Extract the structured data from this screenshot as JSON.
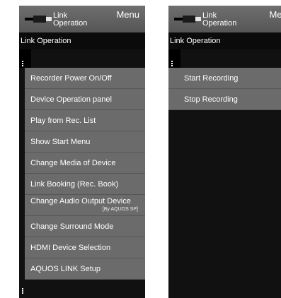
{
  "left": {
    "header_title": "Link\nOperation",
    "menu_label": "Menu",
    "breadcrumb": "Link Operation",
    "items": [
      {
        "label": "Recorder Power On/Off"
      },
      {
        "label": "Device Operation panel"
      },
      {
        "label": "Play from Rec. List"
      },
      {
        "label": "Show Start Menu"
      },
      {
        "label": "Change Media of Device"
      },
      {
        "label": "Link Booking (Rec. Book)"
      },
      {
        "label": "Change Audio Output Device",
        "sub": "[By AQUOS SP]"
      },
      {
        "label": "Change Surround Mode"
      },
      {
        "label": "HDMI Device Selection"
      },
      {
        "label": "AQUOS LINK Setup"
      }
    ]
  },
  "right": {
    "header_title": "Link\nOperation",
    "menu_label": "Menu",
    "breadcrumb": "Link Operation",
    "items": [
      {
        "label": "Start Recording"
      },
      {
        "label": "Stop Recording"
      }
    ]
  }
}
